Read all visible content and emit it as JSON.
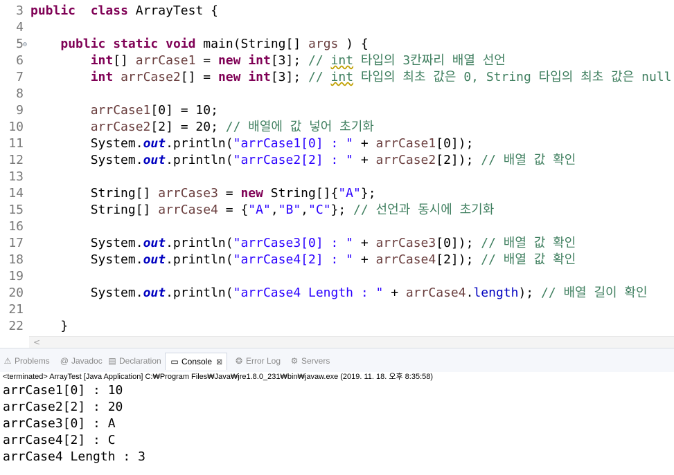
{
  "editor": {
    "lines": [
      {
        "n": "3",
        "fold": "",
        "t": [
          [
            "kw",
            "public"
          ],
          [
            "",
            "  "
          ],
          [
            "kw",
            "class"
          ],
          [
            "",
            " ArrayTest {"
          ]
        ]
      },
      {
        "n": "4",
        "fold": "",
        "t": []
      },
      {
        "n": "5",
        "fold": "⊖",
        "t": [
          [
            "",
            "    "
          ],
          [
            "kw",
            "public"
          ],
          [
            "",
            " "
          ],
          [
            "kw",
            "static"
          ],
          [
            "",
            " "
          ],
          [
            "kw",
            "void"
          ],
          [
            "",
            " main(String[] "
          ],
          [
            "var",
            "args"
          ],
          [
            "",
            " ) {"
          ]
        ]
      },
      {
        "n": "6",
        "fold": "",
        "t": [
          [
            "",
            "        "
          ],
          [
            "kw",
            "int"
          ],
          [
            "",
            "[] "
          ],
          [
            "var",
            "arrCase1"
          ],
          [
            "",
            " = "
          ],
          [
            "kw",
            "new"
          ],
          [
            "",
            " "
          ],
          [
            "kw",
            "int"
          ],
          [
            "",
            "[3]; "
          ],
          [
            "cm",
            "// "
          ],
          [
            "warn",
            "int"
          ],
          [
            "cm",
            " 타입의 3칸짜리 배열 선언"
          ]
        ]
      },
      {
        "n": "7",
        "fold": "",
        "t": [
          [
            "",
            "        "
          ],
          [
            "kw",
            "int"
          ],
          [
            "",
            " "
          ],
          [
            "var",
            "arrCase2"
          ],
          [
            "",
            "[] = "
          ],
          [
            "kw",
            "new"
          ],
          [
            "",
            " "
          ],
          [
            "kw",
            "int"
          ],
          [
            "",
            "[3]; "
          ],
          [
            "cm",
            "// "
          ],
          [
            "warn",
            "int"
          ],
          [
            "cm",
            " 타입의 최초 값은 0, String 타입의 최초 값은 null"
          ]
        ]
      },
      {
        "n": "8",
        "fold": "",
        "t": []
      },
      {
        "n": "9",
        "fold": "",
        "t": [
          [
            "",
            "        "
          ],
          [
            "var",
            "arrCase1"
          ],
          [
            "",
            "[0] = 10;"
          ]
        ]
      },
      {
        "n": "10",
        "fold": "",
        "t": [
          [
            "",
            "        "
          ],
          [
            "var",
            "arrCase2"
          ],
          [
            "",
            "[2] = 20; "
          ],
          [
            "cm",
            "// 배열에 값 넣어 초기화"
          ]
        ]
      },
      {
        "n": "11",
        "fold": "",
        "t": [
          [
            "",
            "        System."
          ],
          [
            "fld",
            "out"
          ],
          [
            "",
            ".println("
          ],
          [
            "str",
            "\"arrCase1[0] : \""
          ],
          [
            "",
            " + "
          ],
          [
            "var",
            "arrCase1"
          ],
          [
            "",
            "[0]);"
          ]
        ]
      },
      {
        "n": "12",
        "fold": "",
        "t": [
          [
            "",
            "        System."
          ],
          [
            "fld",
            "out"
          ],
          [
            "",
            ".println("
          ],
          [
            "str",
            "\"arrCase2[2] : \""
          ],
          [
            "",
            " + "
          ],
          [
            "var",
            "arrCase2"
          ],
          [
            "",
            "[2]); "
          ],
          [
            "cm",
            "// 배열 값 확인"
          ]
        ]
      },
      {
        "n": "13",
        "fold": "",
        "t": []
      },
      {
        "n": "14",
        "fold": "",
        "t": [
          [
            "",
            "        String[] "
          ],
          [
            "var",
            "arrCase3"
          ],
          [
            "",
            " = "
          ],
          [
            "kw",
            "new"
          ],
          [
            "",
            " String[]{"
          ],
          [
            "str",
            "\"A\""
          ],
          [
            "",
            "};"
          ]
        ]
      },
      {
        "n": "15",
        "fold": "",
        "t": [
          [
            "",
            "        String[] "
          ],
          [
            "var",
            "arrCase4"
          ],
          [
            "",
            " = {"
          ],
          [
            "str",
            "\"A\""
          ],
          [
            "",
            ","
          ],
          [
            "str",
            "\"B\""
          ],
          [
            "",
            ","
          ],
          [
            "str",
            "\"C\""
          ],
          [
            "",
            "}; "
          ],
          [
            "cm",
            "// 선언과 동시에 초기화"
          ]
        ]
      },
      {
        "n": "16",
        "fold": "",
        "t": []
      },
      {
        "n": "17",
        "fold": "",
        "t": [
          [
            "",
            "        System."
          ],
          [
            "fld",
            "out"
          ],
          [
            "",
            ".println("
          ],
          [
            "str",
            "\"arrCase3[0] : \""
          ],
          [
            "",
            " + "
          ],
          [
            "var",
            "arrCase3"
          ],
          [
            "",
            "[0]); "
          ],
          [
            "cm",
            "// 배열 값 확인"
          ]
        ]
      },
      {
        "n": "18",
        "fold": "",
        "t": [
          [
            "",
            "        System."
          ],
          [
            "fld",
            "out"
          ],
          [
            "",
            ".println("
          ],
          [
            "str",
            "\"arrCase4[2] : \""
          ],
          [
            "",
            " + "
          ],
          [
            "var",
            "arrCase4"
          ],
          [
            "",
            "[2]); "
          ],
          [
            "cm",
            "// 배열 값 확인"
          ]
        ]
      },
      {
        "n": "19",
        "fold": "",
        "t": []
      },
      {
        "n": "20",
        "fold": "",
        "t": [
          [
            "",
            "        System."
          ],
          [
            "fld",
            "out"
          ],
          [
            "",
            ".println("
          ],
          [
            "str",
            "\"arrCase4 Length : \""
          ],
          [
            "",
            " + "
          ],
          [
            "var",
            "arrCase4"
          ],
          [
            "",
            "."
          ],
          [
            "fld2",
            "length"
          ],
          [
            "",
            "); "
          ],
          [
            "cm",
            "// 배열 길이 확인"
          ]
        ]
      },
      {
        "n": "21",
        "fold": "",
        "t": []
      },
      {
        "n": "22",
        "fold": "",
        "t": [
          [
            "",
            "    }"
          ]
        ]
      }
    ]
  },
  "scrollbar": {
    "left_arrow": "<"
  },
  "tabs": [
    {
      "id": "problems",
      "label": "Problems",
      "icon": "problems-icon",
      "glyph": "⚠"
    },
    {
      "id": "javadoc",
      "label": "Javadoc",
      "icon": "javadoc-icon",
      "glyph": "@"
    },
    {
      "id": "declaration",
      "label": "Declaration",
      "icon": "declaration-icon",
      "glyph": "▤"
    },
    {
      "id": "console",
      "label": "Console",
      "icon": "console-icon",
      "glyph": "▭",
      "active": true,
      "close": "⊠"
    },
    {
      "id": "errorlog",
      "label": "Error Log",
      "icon": "error-log-icon",
      "glyph": "❂"
    },
    {
      "id": "servers",
      "label": "Servers",
      "icon": "servers-icon",
      "glyph": "⚙"
    }
  ],
  "status": "<terminated> ArrayTest [Java Application] C:₩Program Files₩Java₩jre1.8.0_231₩bin₩javaw.exe (2019. 11. 18. 오후 8:35:58)",
  "console": [
    "arrCase1[0] : 10",
    "arrCase2[2] : 20",
    "arrCase3[0] : A",
    "arrCase4[2] : C",
    "arrCase4 Length : 3"
  ]
}
